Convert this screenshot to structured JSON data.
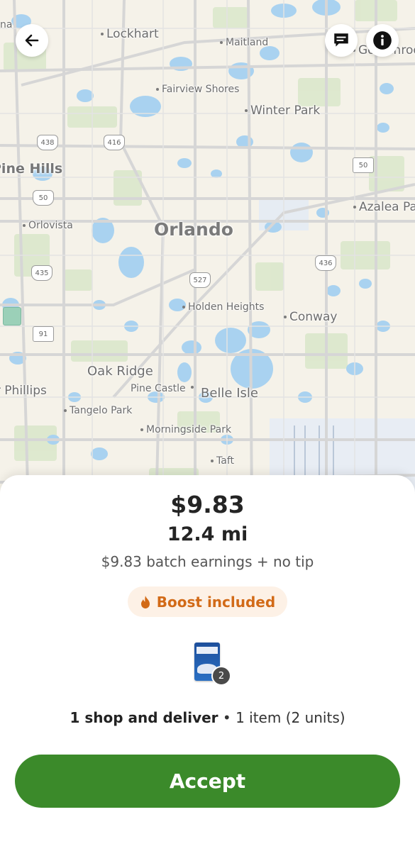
{
  "map": {
    "places": {
      "lockhart": "Lockhart",
      "maitland": "Maitland",
      "goldenrod": "Goldenrod",
      "fairview": "Fairview Shores",
      "winter_park": "Winter Park",
      "pine_hills": "Pine Hills",
      "azalea": "Azalea Park",
      "orlovista": "Orlovista",
      "orlando": "Orlando",
      "holden": "Holden Heights",
      "conway": "Conway",
      "oak_ridge": "Oak Ridge",
      "doctor_phillips": "Doctor Phillips",
      "pine_castle": "Pine Castle",
      "belle_isle": "Belle Isle",
      "tangelo": "Tangelo Park",
      "morningside": "Morningside Park",
      "taft": "Taft",
      "na": "na"
    },
    "shields": {
      "s438": "438",
      "s416": "416",
      "s50a": "50",
      "s50b": "50",
      "s435": "435",
      "s527": "527",
      "s436": "436",
      "s91": "91"
    }
  },
  "header": {
    "back_icon": "arrow-left-icon",
    "chat_icon": "chat-icon",
    "info_icon": "info-icon"
  },
  "offer": {
    "price": "$9.83",
    "distance": "12.4 mi",
    "earnings_text": "$9.83 batch earnings + no tip",
    "boost_label": "Boost included",
    "item_quantity": "2",
    "summary_bold": "1 shop and deliver",
    "summary_rest": " • 1 item (2 units)",
    "accept_label": "Accept",
    "colors": {
      "accept": "#3b8a2a",
      "boost_text": "#d26a17",
      "boost_bg": "#fdf1e6"
    }
  }
}
